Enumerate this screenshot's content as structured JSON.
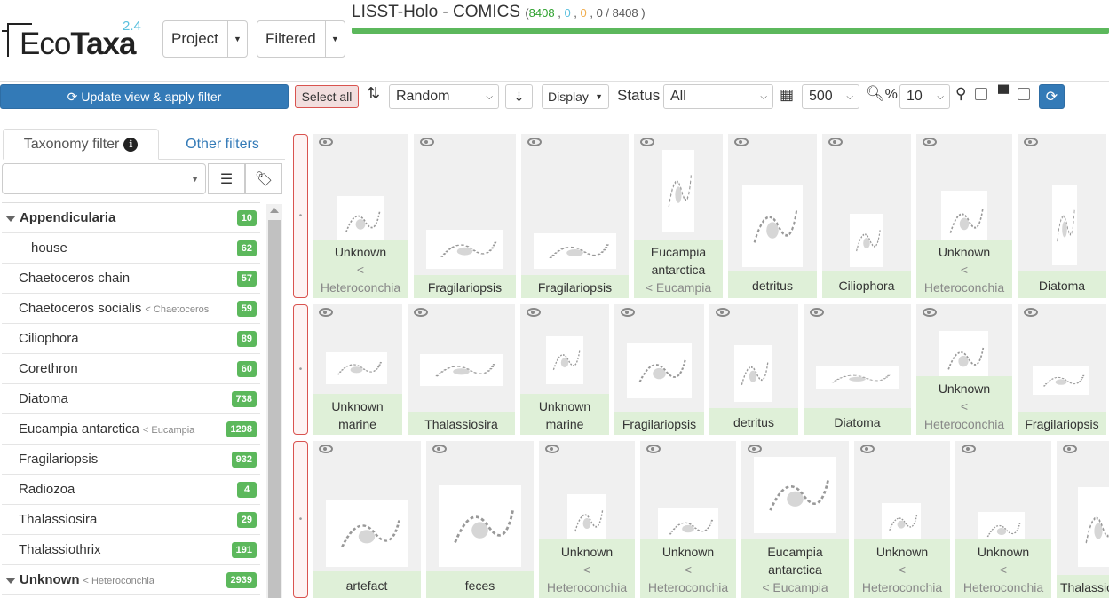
{
  "logo": {
    "eco": "Eco",
    "taxa": "Taxa",
    "version": "2.4"
  },
  "menu": {
    "project": "Project",
    "filtered": "Filtered"
  },
  "header": {
    "title": "LISST-Holo - COMICS",
    "count_validated": "8408",
    "count_dubious": "0",
    "count_predicted": "0",
    "count_rest": "0 / 8408 )",
    "progress_fraction": 1.0,
    "colors": {
      "progress": "#5cb85c",
      "validated": "#2ca02c",
      "dubious": "#5bc0de",
      "predicted": "#f0ad4e"
    }
  },
  "toolbar": {
    "update_label": "Update view & apply filter",
    "select_all_label": "Select all",
    "sort_value": "Random",
    "display_label": "Display",
    "status_label": "Status",
    "status_value": "All",
    "page_size_value": "500",
    "zoom_label": "%",
    "zoom_value": "10"
  },
  "sidebar": {
    "tab_taxonomy": "Taxonomy filter",
    "tab_other": "Other filters",
    "info_glyph": "i",
    "items": [
      {
        "label": "Appendicularia",
        "parent": "",
        "count": "10",
        "type": "parent"
      },
      {
        "label": "house",
        "parent": "",
        "count": "62",
        "type": "child"
      },
      {
        "label": "Chaetoceros chain",
        "parent": "",
        "count": "57",
        "type": "normal"
      },
      {
        "label": "Chaetoceros socialis",
        "parent": "< Chaetoceros",
        "count": "59",
        "type": "normal"
      },
      {
        "label": "Ciliophora",
        "parent": "",
        "count": "89",
        "type": "normal"
      },
      {
        "label": "Corethron",
        "parent": "",
        "count": "60",
        "type": "normal"
      },
      {
        "label": "Diatoma",
        "parent": "",
        "count": "738",
        "type": "normal"
      },
      {
        "label": "Eucampia antarctica",
        "parent": "< Eucampia",
        "count": "1298",
        "type": "normal"
      },
      {
        "label": "Fragilariopsis",
        "parent": "",
        "count": "932",
        "type": "normal"
      },
      {
        "label": "Radiozoa",
        "parent": "",
        "count": "4",
        "type": "normal"
      },
      {
        "label": "Thalassiosira",
        "parent": "",
        "count": "29",
        "type": "normal"
      },
      {
        "label": "Thalassiothrix",
        "parent": "",
        "count": "191",
        "type": "normal"
      },
      {
        "label": "Unknown",
        "parent": "< Heteroconchia",
        "count": "2939",
        "type": "parent"
      }
    ]
  },
  "grid": {
    "rows": [
      [
        {
          "name": "Unknown",
          "parent": "< Heteroconchia"
        },
        {
          "name": "Fragilariopsis",
          "parent": ""
        },
        {
          "name": "Fragilariopsis",
          "parent": ""
        },
        {
          "name": "Eucampia antarctica",
          "parent": "< Eucampia"
        },
        {
          "name": "detritus",
          "parent": ""
        },
        {
          "name": "Ciliophora",
          "parent": ""
        },
        {
          "name": "Unknown",
          "parent": "< Heteroconchia"
        },
        {
          "name": "Diatoma",
          "parent": ""
        }
      ],
      [
        {
          "name": "Unknown marine",
          "parent": ""
        },
        {
          "name": "Thalassiosira",
          "parent": ""
        },
        {
          "name": "Unknown marine",
          "parent": ""
        },
        {
          "name": "Fragilariopsis",
          "parent": ""
        },
        {
          "name": "detritus",
          "parent": ""
        },
        {
          "name": "Diatoma",
          "parent": ""
        },
        {
          "name": "Unknown",
          "parent": "< Heteroconchia"
        },
        {
          "name": "Fragilariopsis",
          "parent": ""
        }
      ],
      [
        {
          "name": "artefact",
          "parent": ""
        },
        {
          "name": "feces",
          "parent": ""
        },
        {
          "name": "Unknown",
          "parent": "< Heteroconchia"
        },
        {
          "name": "Unknown",
          "parent": "< Heteroconchia"
        },
        {
          "name": "Eucampia antarctica",
          "parent": "< Eucampia"
        },
        {
          "name": "Unknown",
          "parent": "< Heteroconchia"
        },
        {
          "name": "Unknown",
          "parent": "< Heteroconchia"
        },
        {
          "name": "Thalassiothrix",
          "parent": ""
        }
      ]
    ]
  }
}
